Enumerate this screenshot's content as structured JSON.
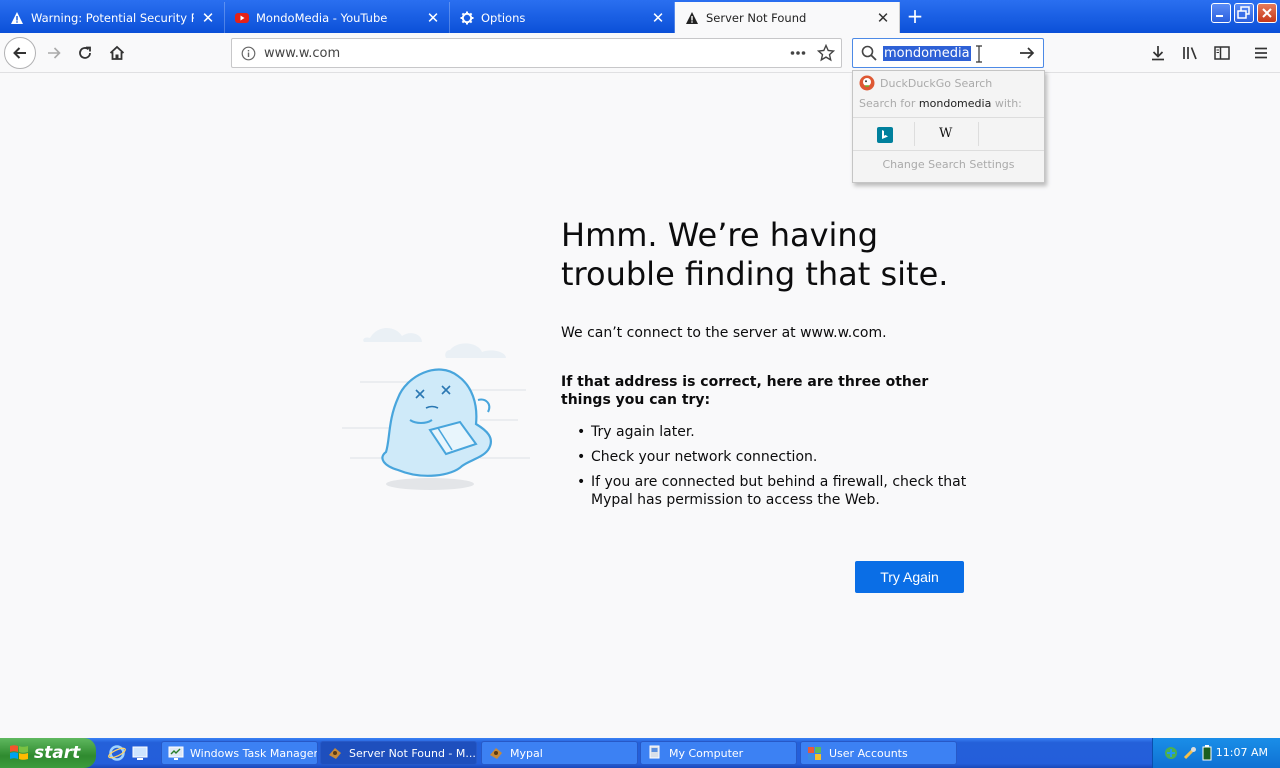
{
  "tabs": [
    {
      "title": "Warning: Potential Security Risk Ahead",
      "icon": "warning-icon",
      "active": false
    },
    {
      "title": "MondoMedia - YouTube",
      "icon": "youtube-icon",
      "active": false
    },
    {
      "title": "Options",
      "icon": "gear-icon",
      "active": false
    },
    {
      "title": "Server Not Found",
      "icon": "warning-icon",
      "active": true
    }
  ],
  "navbar": {
    "url": "www.w.com"
  },
  "search": {
    "value": "mondomedia",
    "popup": {
      "engine_name": "DuckDuckGo Search",
      "search_for_prefix": "Search for",
      "search_for_term": "mondomedia",
      "search_for_suffix": "with:",
      "engines": [
        "bing-icon",
        "wikipedia-icon"
      ],
      "wikipedia_glyph": "W",
      "settings_label": "Change Search Settings"
    }
  },
  "error": {
    "title": "Hmm. We’re having trouble finding that site.",
    "description": "We can’t connect to the server at www.w.com.",
    "heading": "If that address is correct, here are three other things you can try:",
    "suggestions": [
      "Try again later.",
      "Check your network connection.",
      "If you are connected but behind a firewall, check that Mypal has permission to access the Web."
    ],
    "try_again_label": "Try Again"
  },
  "taskbar": {
    "start_label": "start",
    "items": [
      {
        "label": "Windows Task Manager",
        "active": false
      },
      {
        "label": "Server Not Found - M...",
        "active": true
      },
      {
        "label": "Mypal",
        "active": false
      },
      {
        "label": "My Computer",
        "active": false
      },
      {
        "label": "User Accounts",
        "active": false
      }
    ],
    "clock": "11:07 AM"
  },
  "colors": {
    "accent": "#0a6ee6",
    "titlebar": "#0b50d8",
    "selection": "#2e61d6"
  }
}
